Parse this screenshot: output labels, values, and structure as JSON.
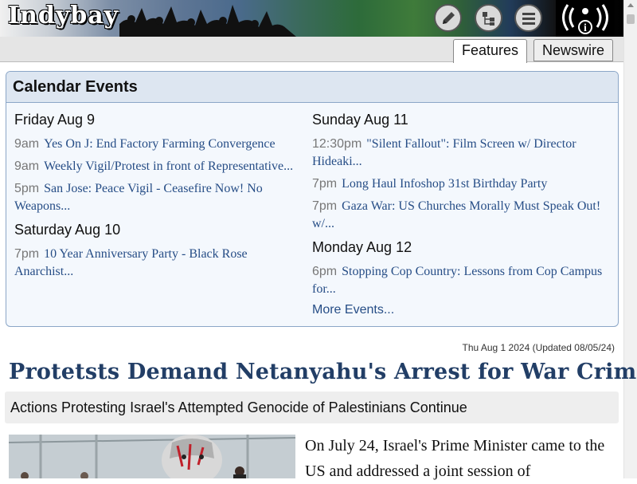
{
  "site": {
    "logo_text": "Indybay",
    "icons": [
      "pencil-icon",
      "sitemap-icon",
      "menu-icon",
      "radio-icon"
    ],
    "radio_label": "i"
  },
  "tabs": [
    {
      "label": "Features",
      "active": true
    },
    {
      "label": "Newswire",
      "active": false
    }
  ],
  "calendar": {
    "title": "Calendar Events",
    "left_column": [
      {
        "day": "Friday Aug 9",
        "events": [
          {
            "time": "9am",
            "title": "Yes On J: End Factory Farming Convergence"
          },
          {
            "time": "9am",
            "title": "Weekly Vigil/Protest in front of Representative..."
          },
          {
            "time": "5pm",
            "title": "San Jose: Peace Vigil - Ceasefire Now! No Weapons..."
          }
        ]
      },
      {
        "day": "Saturday Aug 10",
        "events": [
          {
            "time": "7pm",
            "title": "10 Year Anniversary Party - Black Rose Anarchist..."
          }
        ]
      }
    ],
    "right_column": [
      {
        "day": "Sunday Aug 11",
        "events": [
          {
            "time": "12:30pm",
            "title": "\"Silent Fallout\": Film Screen w/ Director Hideaki..."
          },
          {
            "time": "7pm",
            "title": "Long Haul Infoshop 31st Birthday Party"
          },
          {
            "time": "7pm",
            "title": "Gaza War: US Churches Morally Must Speak Out! w/..."
          }
        ]
      },
      {
        "day": "Monday Aug 12",
        "events": [
          {
            "time": "6pm",
            "title": "Stopping Cop Country: Lessons from Cop Campus for..."
          }
        ]
      }
    ],
    "more_events": "More Events..."
  },
  "article": {
    "date": "Thu Aug 1 2024 (Updated 08/05/24)",
    "headline": "Protetsts Demand Netanyahu's Arrest for War Crimes",
    "subhead": "Actions Protesting Israel's Attempted Genocide of Palestinians Continue",
    "body_lead": "On July 24, Israel's Prime Minister came to the US and addressed a joint session of"
  },
  "colors": {
    "link": "#264d86",
    "headline": "#223e66",
    "calendar_bg": "#f4f8fd",
    "calendar_header_bg": "#dde6f1",
    "calendar_border": "#8ba6c7"
  }
}
